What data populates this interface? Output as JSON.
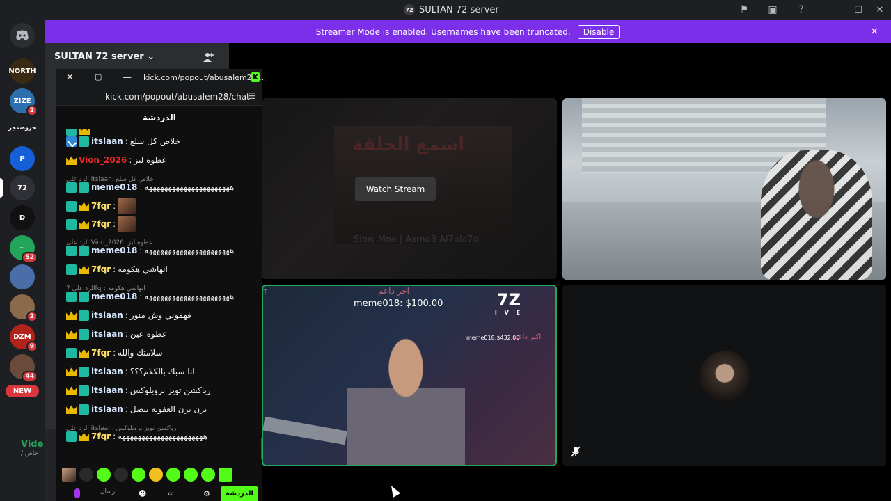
{
  "window": {
    "title": "SULTAN 72 server",
    "logo_text": "72"
  },
  "banner": {
    "message": "Streamer Mode is enabled. Usernames have been truncated.",
    "disable_label": "Disable",
    "close_icon": "×"
  },
  "guilds": {
    "home_icon": "discord-logo",
    "items": [
      {
        "label": "NORTH",
        "badge": "",
        "color": "#3a2a14"
      },
      {
        "label": "ZIZE",
        "badge": "2",
        "color": "#2e6fb0"
      },
      {
        "label": "حروضمجز",
        "badge": "",
        "color": "#1e1f22"
      },
      {
        "label": "P",
        "badge": "",
        "color": "#1560d8"
      },
      {
        "label": "72",
        "badge": "",
        "color": "#2f3136"
      },
      {
        "label": "D",
        "badge": "",
        "color": "#111111"
      },
      {
        "label": "~",
        "badge": "52",
        "color": "#23a55a"
      },
      {
        "label": "",
        "badge": "",
        "color": "#4a6ea8"
      },
      {
        "label": "",
        "badge": "2",
        "color": "#8a6a4a"
      },
      {
        "label": "DZM",
        "badge": "9",
        "color": "#b0241c"
      },
      {
        "label": "",
        "badge": "44",
        "color": "#6a4a3a"
      }
    ],
    "count": "1",
    "new_label": "NEW"
  },
  "channel_sidebar": {
    "server_name": "SULTAN 72 server",
    "chevron": "⌄",
    "voice_label": "Vide",
    "voice_sub": "/ خاص"
  },
  "popout": {
    "window_title": "kick.com/popout/abusalem28...",
    "url": "kick.com/popout/abusalem28/chat",
    "kick_letter": "K",
    "chat_header": "الدردشة",
    "messages": [
      {
        "kind": "msg",
        "badges": [
          "vip",
          "kick"
        ],
        "user": "itslaan",
        "ucls": "u-itslaan",
        "text": "خلاص كل سلع"
      },
      {
        "kind": "msg",
        "badges": [
          "crown"
        ],
        "user": "Vion_2026",
        "ucls": "u-vion",
        "text": "عطوه ليز"
      },
      {
        "kind": "reply",
        "text": "الرد على itslaan: خلاص كل سلع"
      },
      {
        "kind": "msg",
        "badges": [
          "kick",
          "kick"
        ],
        "user": "meme018",
        "ucls": "u-meme",
        "text": "ههههههههههههههههههههههه"
      },
      {
        "kind": "msg",
        "badges": [
          "kick",
          "crown"
        ],
        "user": "7fqr",
        "ucls": "u-7fqr",
        "text": "",
        "thumb": true
      },
      {
        "kind": "msg",
        "badges": [
          "kick",
          "crown"
        ],
        "user": "7fqr",
        "ucls": "u-7fqr",
        "text": "",
        "thumb": true
      },
      {
        "kind": "reply",
        "text": "الرد على Vion_2026: عطوه ليز"
      },
      {
        "kind": "msg",
        "badges": [
          "kick",
          "kick"
        ],
        "user": "meme018",
        "ucls": "u-meme",
        "text": "ههههههههههههههههههههههه"
      },
      {
        "kind": "msg",
        "badges": [
          "kick",
          "crown"
        ],
        "user": "7fqr",
        "ucls": "u-7fqr",
        "text": "انهاشي هكومه"
      },
      {
        "kind": "reply",
        "text": "الرد على 7fqr: انهاشي هكومه"
      },
      {
        "kind": "msg",
        "badges": [
          "kick",
          "kick"
        ],
        "user": "meme018",
        "ucls": "u-meme",
        "text": "ههههههههههههههههههههههه"
      },
      {
        "kind": "msg",
        "badges": [
          "crown",
          "kick"
        ],
        "user": "itslaan",
        "ucls": "u-itslaan",
        "text": "فهموني وش منور"
      },
      {
        "kind": "msg",
        "badges": [
          "crown",
          "kick"
        ],
        "user": "itslaan",
        "ucls": "u-itslaan",
        "text": "عطوه عين"
      },
      {
        "kind": "msg",
        "badges": [
          "kick",
          "crown"
        ],
        "user": "7fqr",
        "ucls": "u-7fqr",
        "text": "سلامتك والله"
      },
      {
        "kind": "msg",
        "badges": [
          "crown",
          "kick"
        ],
        "user": "itslaan",
        "ucls": "u-itslaan",
        "text": "انا سبك بالكلام؟؟؟"
      },
      {
        "kind": "msg",
        "badges": [
          "crown",
          "kick"
        ],
        "user": "itslaan",
        "ucls": "u-itslaan",
        "text": "رياكشن تويز بروبلوكس"
      },
      {
        "kind": "msg",
        "badges": [
          "crown",
          "kick"
        ],
        "user": "itslaan",
        "ucls": "u-itslaan",
        "text": "ترن ترن العفويه تتصل"
      },
      {
        "kind": "reply",
        "text": "الرد على itslaan: رياكشن تويز بروبلوكس"
      },
      {
        "kind": "msg",
        "badges": [
          "kick",
          "crown"
        ],
        "user": "7fqr",
        "ucls": "u-7fqr",
        "text": "ههههههههههههههههههههههه"
      }
    ],
    "send_placeholder": "ارسال",
    "send_sub": "رسالة",
    "chat_button": "الدردشة"
  },
  "stage": {
    "tile1": {
      "watch_label": "Watch Stream",
      "poster_title": "اسمع الحلقة",
      "poster_sub": "Slow Moe | Asma3 Al7ala7a"
    },
    "tile3": {
      "top_label": "اخر داعم",
      "donor": "meme018: $100.00",
      "side_amount": "meme018:$432.00",
      "side_label": "اكبر داعم",
      "logo": "7Z",
      "logo_sub": "I V E",
      "tag": "T"
    },
    "tile4": {
      "muted_icon": "🎙̸"
    }
  }
}
